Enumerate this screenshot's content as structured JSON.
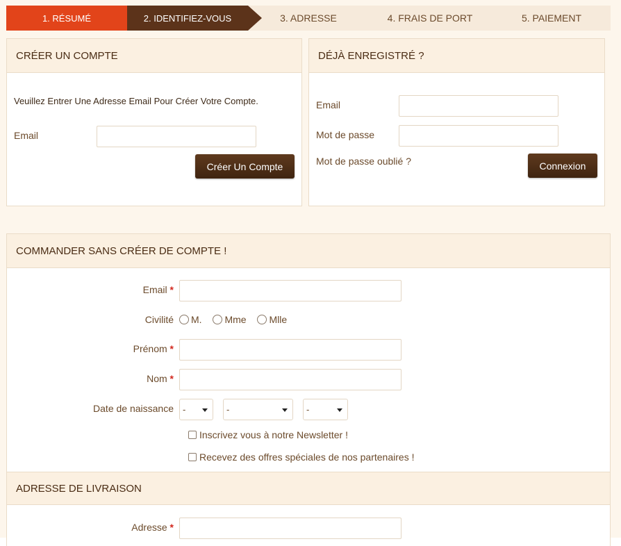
{
  "steps": [
    "1. RÉSUMÉ",
    "2. IDENTIFIEZ-VOUS",
    "3. ADRESSE",
    "4. FRAIS DE PORT",
    "5. PAIEMENT"
  ],
  "create": {
    "title": "CRÉER UN COMPTE",
    "intro": "Veuillez Entrer Une Adresse Email Pour Créer Votre Compte.",
    "email_label": "Email",
    "email_value": "",
    "button": "Créer Un Compte"
  },
  "login": {
    "title": "DÉJÀ ENREGISTRÉ ?",
    "email_label": "Email",
    "email_value": "",
    "password_label": "Mot de passe",
    "password_value": "",
    "forgot": "Mot de passe oublié ?",
    "button": "Connexion"
  },
  "guest": {
    "title": "COMMANDER SANS CRÉER DE COMPTE !",
    "required_mark": "*",
    "email_label": "Email",
    "civility_label": "Civilité",
    "civility_options": [
      "M.",
      "Mme",
      "Mlle"
    ],
    "firstname_label": "Prénom",
    "lastname_label": "Nom",
    "birth_label": "Date de naissance",
    "birth_day": "-",
    "birth_month": "-",
    "birth_year": "-",
    "newsletter": "Inscrivez vous à notre Newsletter !",
    "optin": "Recevez des offres spéciales de nos partenaires !"
  },
  "delivery": {
    "title": "ADRESSE DE LIVRAISON",
    "address_label": "Adresse"
  },
  "colors": {
    "step_active": "#e2441a",
    "step_current": "#5c331a",
    "button": "#4a2a14",
    "required": "#d2281e"
  }
}
